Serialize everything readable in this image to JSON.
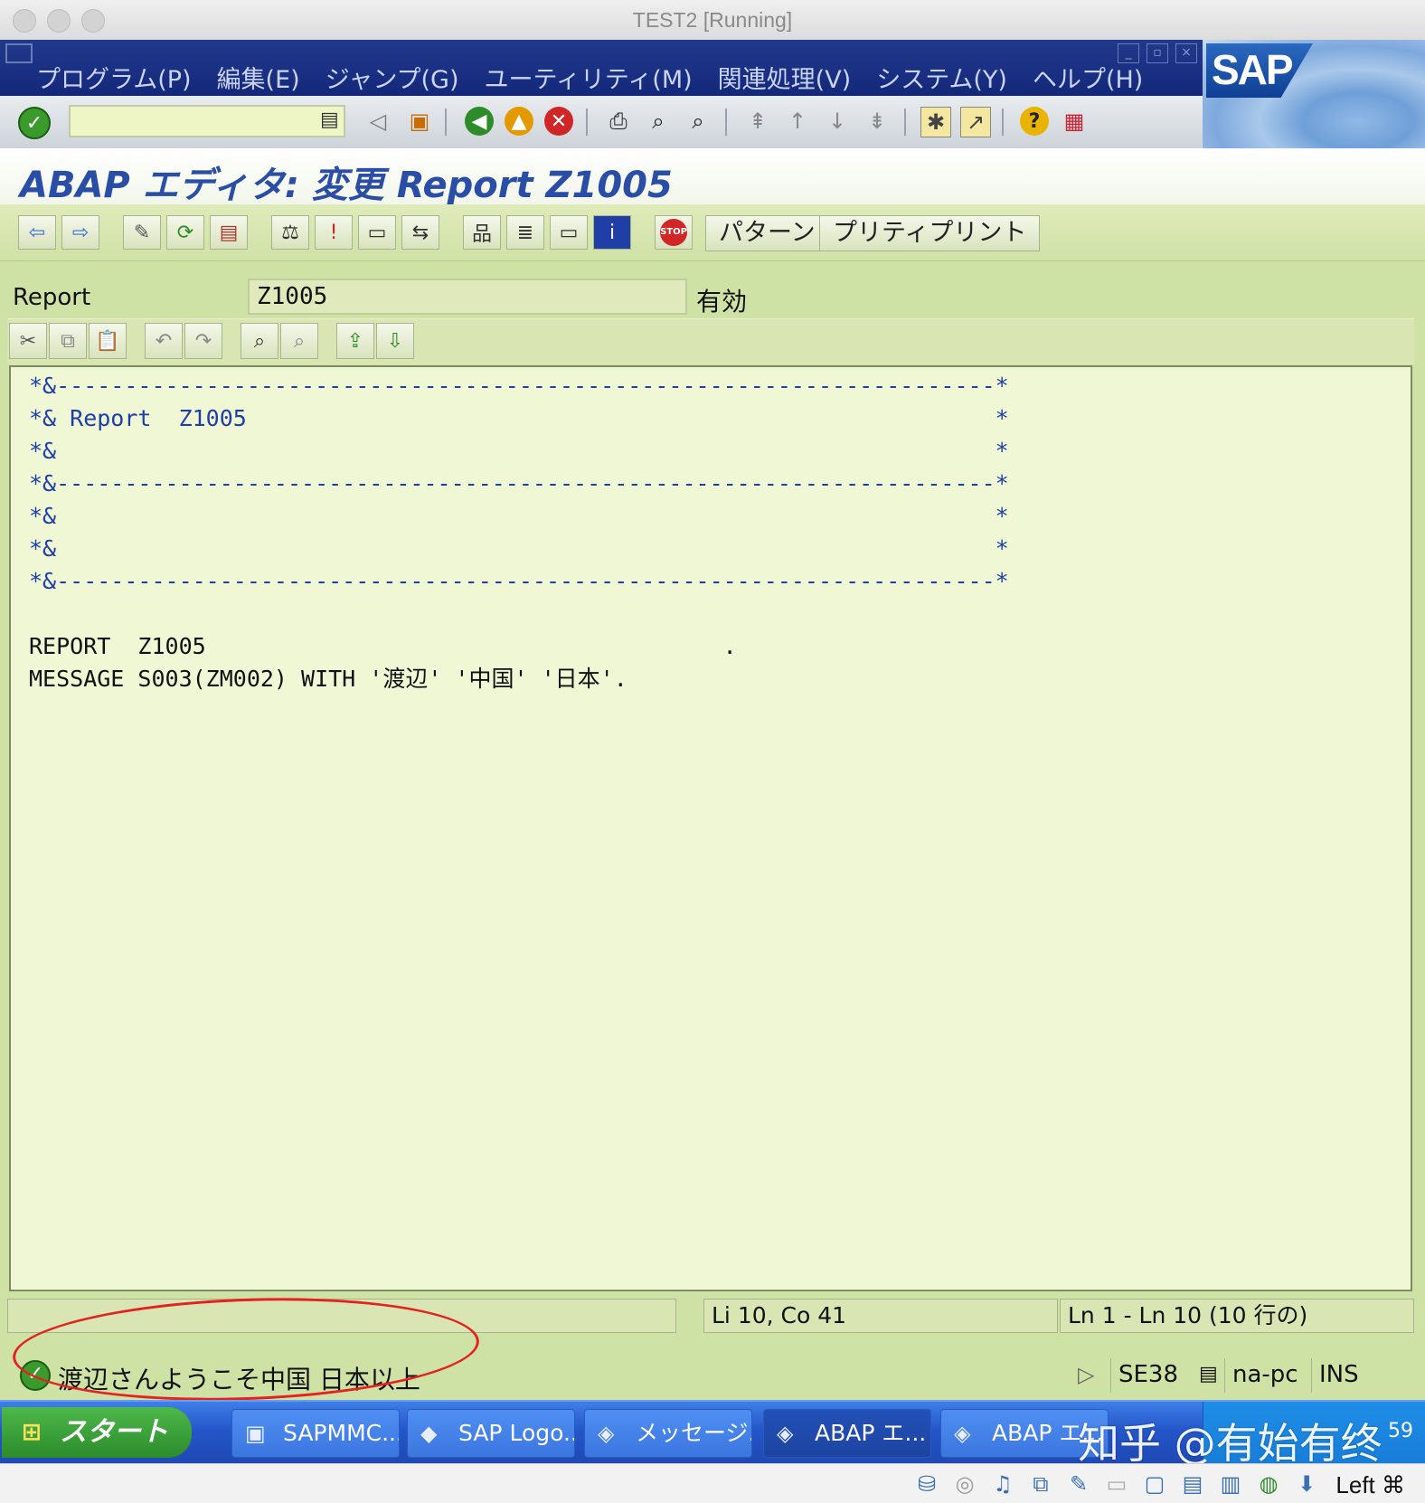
{
  "window": {
    "title": "TEST2 [Running]"
  },
  "menu": [
    "プログラム(P)",
    "編集(E)",
    "ジャンプ(G)",
    "ユーティリティ(M)",
    "関連処理(V)",
    "システム(Y)",
    "ヘルプ(H)"
  ],
  "brand": {
    "logo": "SAP"
  },
  "toolbar": {
    "command_value": ""
  },
  "page": {
    "title": "ABAP エディタ: 変更 Report Z1005"
  },
  "app_toolbar": {
    "pattern_label": "パターン",
    "pretty_print_label": "プリティプリント"
  },
  "report": {
    "label": "Report",
    "value": "Z1005",
    "status": "有効"
  },
  "editor": {
    "lines": [
      "*&---------------------------------------------------------------------*",
      "*& Report  Z1005                                                       *",
      "*&                                                                     *",
      "*&---------------------------------------------------------------------*",
      "*&                                                                     *",
      "*&                                                                     *",
      "*&---------------------------------------------------------------------*",
      "",
      "REPORT  Z1005                                      .",
      "MESSAGE S003(ZM002) WITH '渡辺' '中国' '日本'."
    ]
  },
  "position": {
    "cursor": "Li 10, Co 41",
    "range": "Ln 1 - Ln 10 (10 行の)"
  },
  "status_bar": {
    "message": "渡辺さんようこそ中国 日本以上",
    "transaction": "SE38",
    "server": "na-pc",
    "mode": "INS"
  },
  "taskbar": {
    "start_label": "スタート",
    "items": [
      {
        "label": "SAPMMC..."
      },
      {
        "label": "SAP Logo..."
      },
      {
        "label": "メッセージ..."
      },
      {
        "label": "ABAP エ..."
      },
      {
        "label": "ABAP エ..."
      }
    ],
    "clock_fragment": "59"
  },
  "watermark": "知乎 @有始有终",
  "host_key": "Left ⌘",
  "colors": {
    "menubar": "#1b3184",
    "editor_bg": "#eff7d4",
    "comment": "#1f3fa6",
    "annotation": "#e32222"
  }
}
